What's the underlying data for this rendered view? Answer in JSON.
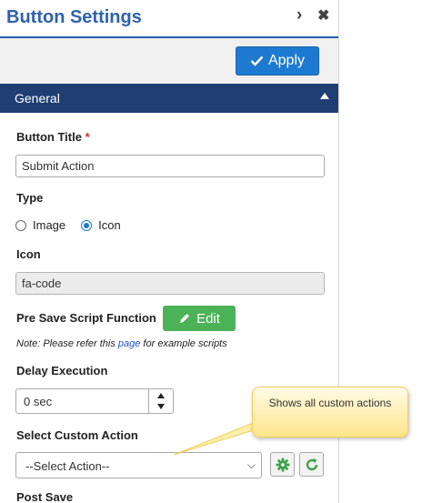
{
  "header": {
    "title": "Button Settings",
    "expand_glyph": "›",
    "close_glyph": "✖"
  },
  "toolbar": {
    "apply_label": "Apply",
    "apply_icon": "check-icon"
  },
  "section": {
    "title": "General"
  },
  "form": {
    "button_title": {
      "label": "Button Title",
      "required_mark": "*",
      "value": "Submit Action"
    },
    "type": {
      "label": "Type",
      "options": [
        "Image",
        "Icon"
      ],
      "selected": "Icon"
    },
    "icon": {
      "label": "Icon",
      "value": "fa-code"
    },
    "pre_save": {
      "label": "Pre Save Script Function",
      "edit_label": "Edit"
    },
    "note": {
      "prefix": "Note: Please refer this ",
      "link": "page",
      "suffix": " for example scripts"
    },
    "delay": {
      "label": "Delay Execution",
      "value": "0 sec"
    },
    "custom_action": {
      "label": "Select Custom Action",
      "value": "--Select Action--"
    },
    "post_save": {
      "label": "Post Save"
    }
  },
  "callout": {
    "text": "Shows all custom actions"
  },
  "colors": {
    "accent": "#1e7ad0",
    "section_bg": "#1f3f73",
    "edit_green": "#4cb258",
    "title_blue": "#2d62ad"
  }
}
